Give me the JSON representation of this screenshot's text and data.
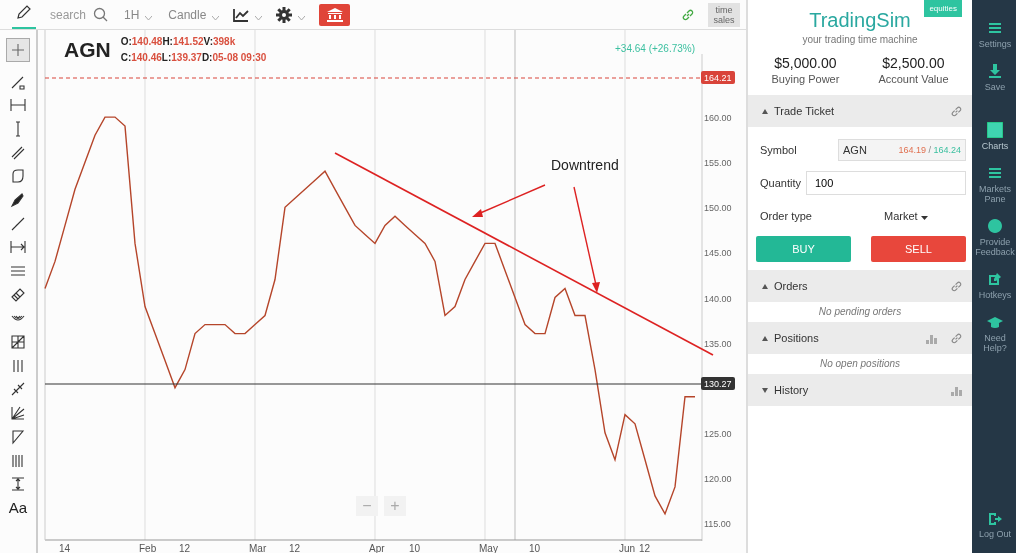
{
  "toolbar": {
    "search": {
      "placeholder": "search"
    },
    "interval": "1H",
    "chart_type": "Candle",
    "time_sales": "time sales"
  },
  "tools": [
    {
      "selected": true
    },
    {
      "selected": false
    },
    {
      "selected": false
    },
    {
      "selected": false
    },
    {
      "selected": false
    },
    {
      "selected": false
    },
    {
      "selected": false
    },
    {
      "selected": false
    },
    {
      "selected": false
    },
    {
      "selected": false
    },
    {
      "selected": false
    },
    {
      "selected": false
    },
    {
      "selected": false
    },
    {
      "selected": false
    },
    {
      "selected": false
    },
    {
      "selected": false
    },
    {
      "selected": false
    },
    {
      "selected": false
    },
    {
      "selected": false
    }
  ],
  "text_tool": "Aa",
  "chart": {
    "symbol": "AGN",
    "quote_rows": [
      [
        {
          "label": "O:",
          "value": "140.48"
        },
        {
          "label": "H:",
          "value": "141.52"
        },
        {
          "label": "V:",
          "value": "398k"
        }
      ],
      [
        {
          "label": "C:",
          "value": "140.46"
        },
        {
          "label": "L:",
          "value": "139.37"
        },
        {
          "label": "D:",
          "value": "05-08 09:30"
        }
      ]
    ],
    "change": "+34.64 (+26.73%)",
    "zoom_out": "−",
    "zoom_in": "+",
    "price_tags": [
      {
        "text": "164.21",
        "color": "#d9443a"
      },
      {
        "text": "130.27",
        "color": "#333333"
      }
    ],
    "chart_data": {
      "type": "line",
      "ylim": [
        113,
        167
      ],
      "categories": [
        null,
        null,
        "14",
        null,
        null,
        null,
        null,
        null,
        null,
        null,
        "Feb",
        null,
        null,
        null,
        "12",
        null,
        null,
        null,
        null,
        null,
        null,
        "Mar",
        null,
        null,
        null,
        "12",
        null,
        null,
        null,
        null,
        null,
        null,
        null,
        "Apr",
        null,
        null,
        null,
        "10",
        null,
        null,
        null,
        null,
        null,
        null,
        "May",
        null,
        null,
        null,
        null,
        "10",
        null,
        null,
        null,
        null,
        null,
        null,
        null,
        null,
        "Jun",
        null,
        "12",
        null,
        null,
        null,
        null,
        null
      ],
      "yticks": [
        {
          "value": 115,
          "label": "115.00"
        },
        {
          "value": 120,
          "label": "120.00"
        },
        {
          "value": 125,
          "label": "125.00"
        },
        {
          "value": 135,
          "label": "135.00"
        },
        {
          "value": 140,
          "label": "140.00"
        },
        {
          "value": 145,
          "label": "145.00"
        },
        {
          "value": 150,
          "label": "150.00"
        },
        {
          "value": 155,
          "label": "155.00"
        },
        {
          "value": 160,
          "label": "160.00"
        }
      ],
      "series": [
        {
          "color": "#b5452a",
          "values": [
            141,
            144,
            148,
            152,
            155,
            158,
            160,
            160,
            159,
            146,
            139,
            136,
            133,
            130,
            132,
            136,
            137,
            137,
            137,
            136,
            136,
            137,
            138,
            142,
            150,
            151,
            152,
            153,
            154,
            152,
            150,
            148,
            147,
            146,
            148,
            149,
            148,
            147,
            146,
            144,
            138,
            139,
            142,
            144,
            146,
            146,
            143,
            140,
            137,
            136,
            136,
            140,
            141,
            138,
            138,
            132,
            125,
            122,
            127,
            126,
            122,
            118,
            116,
            119,
            129,
            129
          ]
        }
      ],
      "annotations": [
        {
          "text": "Downtrend"
        }
      ]
    }
  },
  "panel": {
    "logo": "TradingSim",
    "tagline": "your trading time machine",
    "badge": "equities",
    "stats": [
      {
        "value": "$5,000.00",
        "label": "Buying Power"
      },
      {
        "value": "$2,500.00",
        "label": "Account Value"
      }
    ],
    "trade_ticket": {
      "title": "Trade Ticket",
      "expanded": true,
      "symbol_label": "Symbol",
      "symbol": "AGN",
      "bid": "164.19",
      "separator": "/",
      "ask": "164.24",
      "quantity_label": "Quantity",
      "quantity": "100",
      "order_type_label": "Order type",
      "order_type": "Market",
      "buy": "BUY",
      "sell": "SELL"
    },
    "sections": [
      {
        "title": "Orders",
        "expanded": true,
        "chart_icon": false,
        "link_icon": true,
        "empty": "No pending orders"
      },
      {
        "title": "Positions",
        "expanded": true,
        "chart_icon": true,
        "link_icon": true,
        "empty": "No open positions"
      },
      {
        "title": "History",
        "expanded": false,
        "chart_icon": true,
        "link_icon": false
      }
    ]
  },
  "nav": {
    "items": [
      {
        "label": "Settings",
        "selected": false
      },
      {
        "label": "Save",
        "selected": false
      },
      {
        "label": "Charts",
        "selected": true
      },
      {
        "label": "Markets Pane",
        "selected": false
      },
      {
        "label": "Provide Feedback",
        "selected": false
      },
      {
        "label": "Hotkeys",
        "selected": false
      },
      {
        "label": "Need Help?",
        "selected": false
      }
    ],
    "logout": "Log Out"
  }
}
